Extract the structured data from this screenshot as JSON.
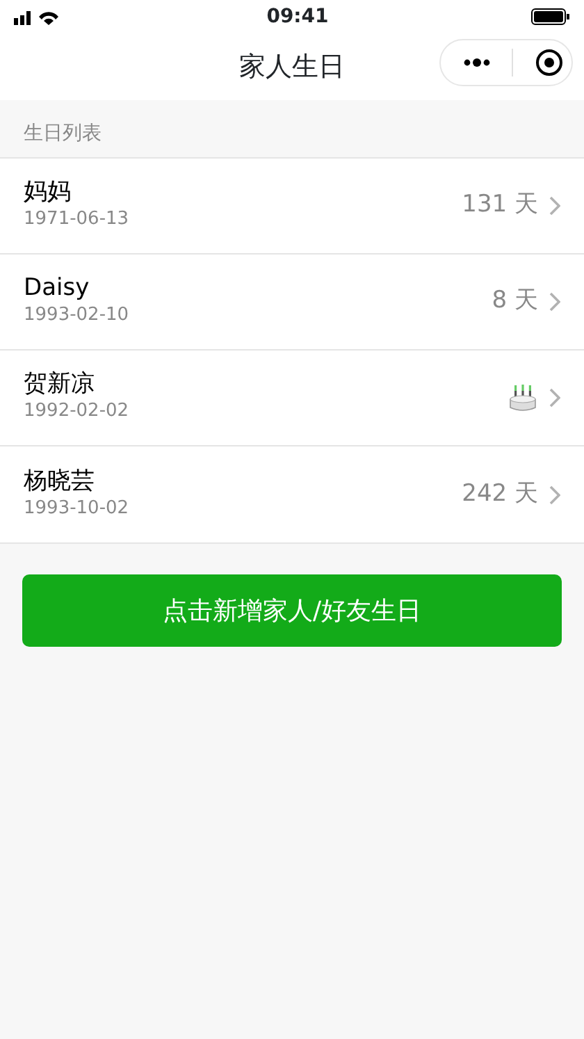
{
  "status_bar": {
    "time": "09:41"
  },
  "nav": {
    "title": "家人生日"
  },
  "section": {
    "title": "生日列表"
  },
  "people": [
    {
      "name": "妈妈",
      "date": "1971-06-13",
      "kind": "countdown",
      "days": "131 天"
    },
    {
      "name": "Daisy",
      "date": "1993-02-10",
      "kind": "countdown",
      "days": "8 天"
    },
    {
      "name": "贺新凉",
      "date": "1992-02-02",
      "kind": "today"
    },
    {
      "name": "杨晓芸",
      "date": "1993-10-02",
      "kind": "countdown",
      "days": "242 天"
    }
  ],
  "add_button": {
    "label": "点击新增家人/好友生日"
  }
}
